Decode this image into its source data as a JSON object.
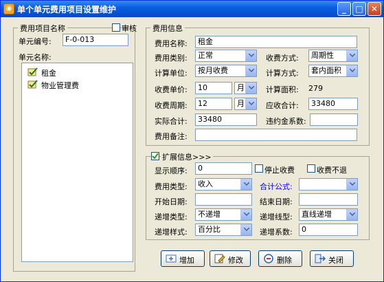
{
  "window": {
    "title": "单个单元费用项目设置维护",
    "app_icon_glyph": "◉",
    "controls": {
      "minimize": "_",
      "maximize": "□",
      "close": "✕"
    }
  },
  "left_panel": {
    "group_title": "费用项目名称",
    "audit_label": "审核",
    "audit_checked": false,
    "unit_no_label": "单元编号:",
    "unit_no_value": "F-0-013",
    "unit_name_label": "单元名称:",
    "items": [
      {
        "label": "租金",
        "icon": "item-icon"
      },
      {
        "label": "物业管理费",
        "icon": "item-icon"
      }
    ]
  },
  "fee_info": {
    "group_title": "费用信息",
    "name_label": "费用名称:",
    "name_value": "租金",
    "category_label": "费用类别:",
    "category_value": "正常",
    "collect_mode_label": "收费方式:",
    "collect_mode_value": "周期性",
    "calc_unit_label": "计算单位:",
    "calc_unit_value": "按月收费",
    "calc_mode_label": "计算方式:",
    "calc_mode_value": "套内面积",
    "unit_price_label": "收费单价:",
    "unit_price_value": "10",
    "unit_price_unit": "月",
    "area_label": "计算面积:",
    "area_value": "279",
    "period_label": "收费周期:",
    "period_value": "12",
    "period_unit": "月",
    "due_total_label": "应收合计:",
    "due_total_value": "33480",
    "actual_total_label": "实际合计:",
    "actual_total_value": "33480",
    "penalty_label": "违约金系数:",
    "penalty_value": "",
    "remark_label": "费用备注:",
    "remark_value": ""
  },
  "ext_info": {
    "group_title": "扩展信息>>>",
    "expanded_checked": true,
    "order_label": "显示顺序:",
    "order_value": "0",
    "stop_label": "停止收费",
    "stop_checked": false,
    "no_refund_label": "收费不退",
    "no_refund_checked": false,
    "fee_type_label": "费用类型:",
    "fee_type_value": "收入",
    "formula_label": "合计公式:",
    "formula_value": "",
    "start_date_label": "开始日期:",
    "start_date_value": "",
    "end_date_label": "结束日期:",
    "end_date_value": "",
    "inc_type_label": "递增类型:",
    "inc_type_value": "不递增",
    "inc_line_label": "递增线型:",
    "inc_line_value": "直线递增",
    "inc_style_label": "递增样式:",
    "inc_style_value": "百分比",
    "inc_coef_label": "递增系数:",
    "inc_coef_value": "0"
  },
  "buttons": {
    "add": "增加",
    "edit": "修改",
    "delete": "删除",
    "close": "关闭"
  },
  "colors": {
    "title_bar": "#0a5fe0",
    "window_bg": "#ece9d8",
    "formula_label": "#0000ff"
  }
}
